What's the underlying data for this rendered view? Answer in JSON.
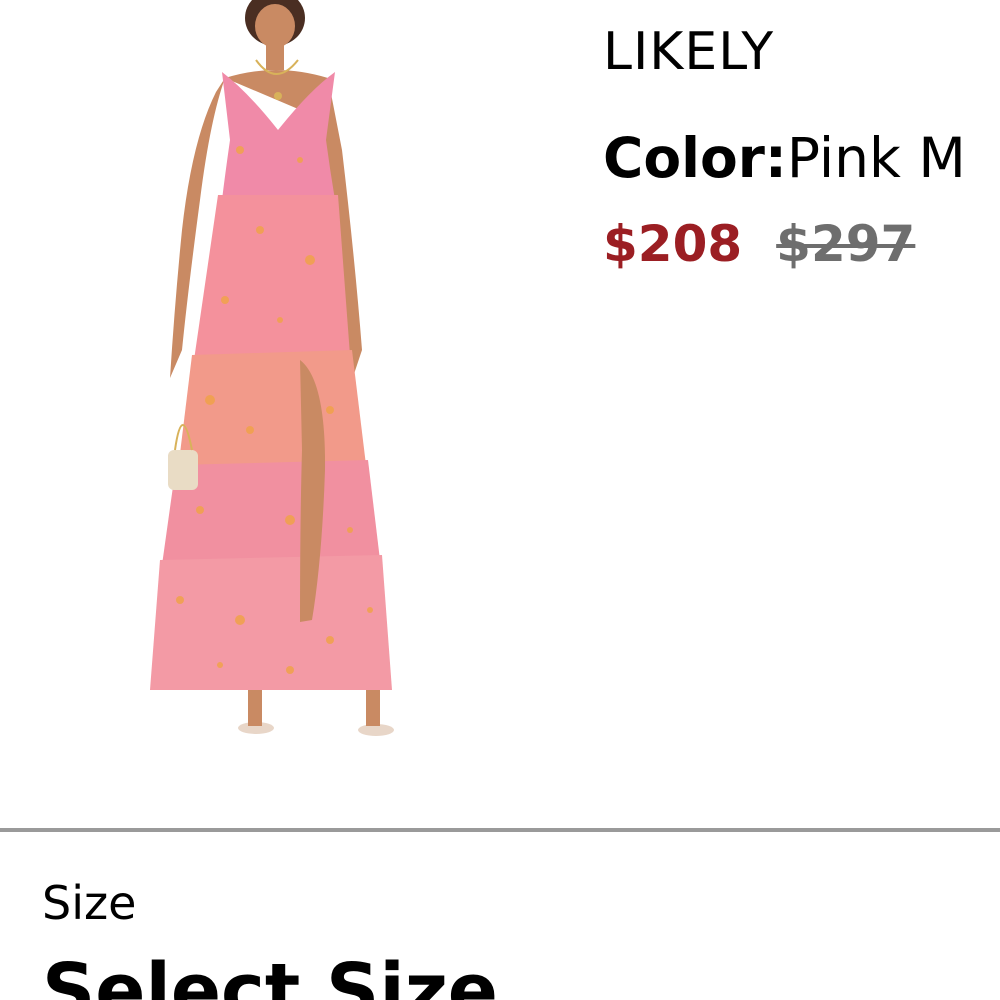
{
  "product": {
    "brand": "LIKELY",
    "color_label": "Color:",
    "color_value": "Pink M",
    "price_sale": "$208",
    "price_original": "$297",
    "image_icon": "product-photo-dress",
    "sale_color": "#9b1e23"
  },
  "size": {
    "label": "Size",
    "select_label": "Select Size"
  }
}
